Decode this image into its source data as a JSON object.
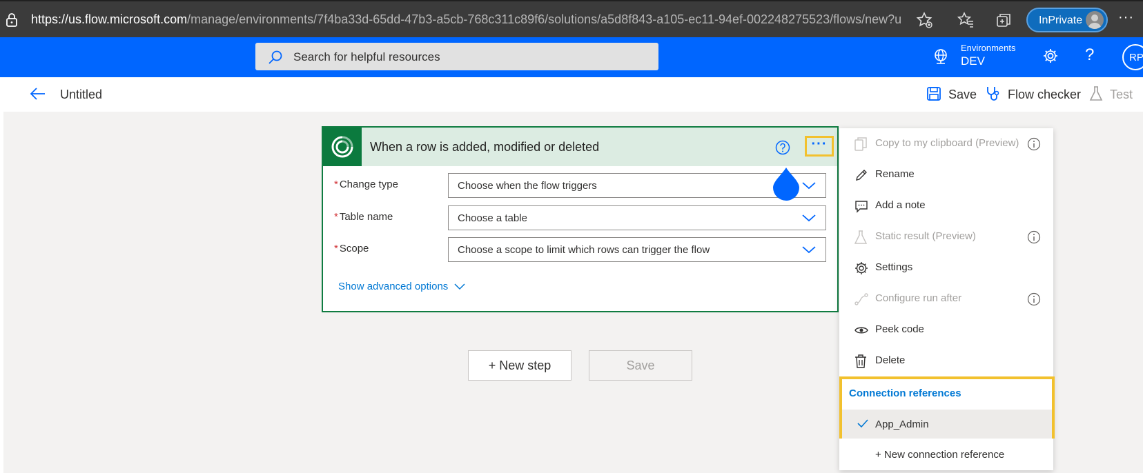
{
  "browser": {
    "url_host": "https://us.flow.microsoft.com",
    "url_path": "/manage/environments/7f4ba33d-65dd-47b3-a5cb-768c311c89f6/solutions/a5d8f843-a105-ec11-94ef-002248275523/flows/new?ut...",
    "inprivate_label": "InPrivate",
    "more_label": "···"
  },
  "header": {
    "search_placeholder": "Search for helpful resources",
    "env_label": "Environments",
    "env_name": "DEV",
    "help_label": "?",
    "avatar_initials": "RP"
  },
  "command_bar": {
    "title": "Untitled",
    "save_label": "Save",
    "checker_label": "Flow checker",
    "test_label": "Test"
  },
  "trigger_card": {
    "title": "When a row is added, modified or deleted",
    "more_label": "···",
    "required_mark": "*",
    "fields": [
      {
        "label": "Change type",
        "value": "Choose when the flow triggers"
      },
      {
        "label": "Table name",
        "value": "Choose a table"
      },
      {
        "label": "Scope",
        "value": "Choose a scope to limit which rows can trigger the flow"
      }
    ],
    "advanced_label": "Show advanced options"
  },
  "canvas": {
    "new_step_label": "+ New step",
    "save_label": "Save"
  },
  "menu": {
    "items": [
      {
        "label": "Copy to my clipboard (Preview)",
        "icon": "copy-icon",
        "disabled": true
      },
      {
        "label": "Rename",
        "icon": "pencil-icon",
        "disabled": false
      },
      {
        "label": "Add a note",
        "icon": "comment-icon",
        "disabled": false
      },
      {
        "label": "Static result (Preview)",
        "icon": "flask-icon",
        "disabled": true
      },
      {
        "label": "Settings",
        "icon": "gear-icon",
        "disabled": false
      },
      {
        "label": "Configure run after",
        "icon": "run-after-icon",
        "disabled": true
      },
      {
        "label": "Peek code",
        "icon": "eye-icon",
        "disabled": false
      },
      {
        "label": "Delete",
        "icon": "trash-icon",
        "disabled": false
      }
    ],
    "connection_references_title": "Connection references",
    "connection_selected": "App_Admin",
    "new_connection_label": "+ New connection reference"
  },
  "colors": {
    "header_blue": "#0066ff",
    "card_green": "#107c41",
    "highlight_yellow": "#f2c12e",
    "link_blue": "#0078d4"
  }
}
